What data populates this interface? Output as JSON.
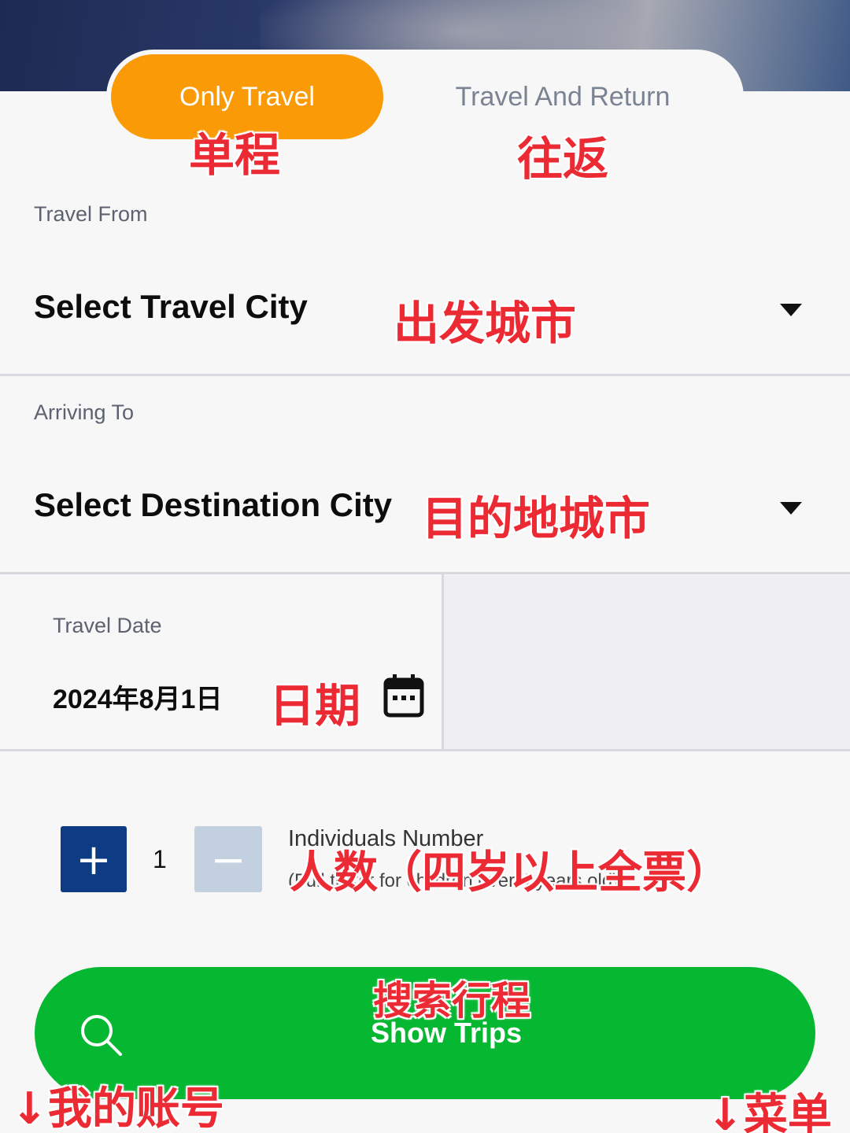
{
  "trip_type": {
    "one_way": "Only Travel",
    "round_trip": "Travel And Return",
    "active_color": "#f99a06"
  },
  "travel_from": {
    "label": "Travel From",
    "value": "Select Travel City"
  },
  "arriving_to": {
    "label": "Arriving To",
    "value": "Select Destination City"
  },
  "travel_date": {
    "label": "Travel Date",
    "value": "2024年8月1日"
  },
  "passengers": {
    "plus": "+",
    "count": "1",
    "minus": "−",
    "title": "Individuals Number",
    "note": "(Full ticket for children over 4 years old)"
  },
  "search": {
    "label": "Show Trips",
    "color": "#06b731"
  },
  "annotations": {
    "one_way": "单程",
    "round_trip": "往返",
    "from_city": "出发城市",
    "to_city": "目的地城市",
    "date": "日期",
    "passengers": "人数（四岁以上全票）",
    "search": "搜索行程",
    "my_account": "↓我的账号",
    "menu": "↓菜单"
  },
  "icons": {
    "dropdown": "caret-down-icon",
    "calendar": "calendar-icon",
    "search": "search-icon"
  }
}
